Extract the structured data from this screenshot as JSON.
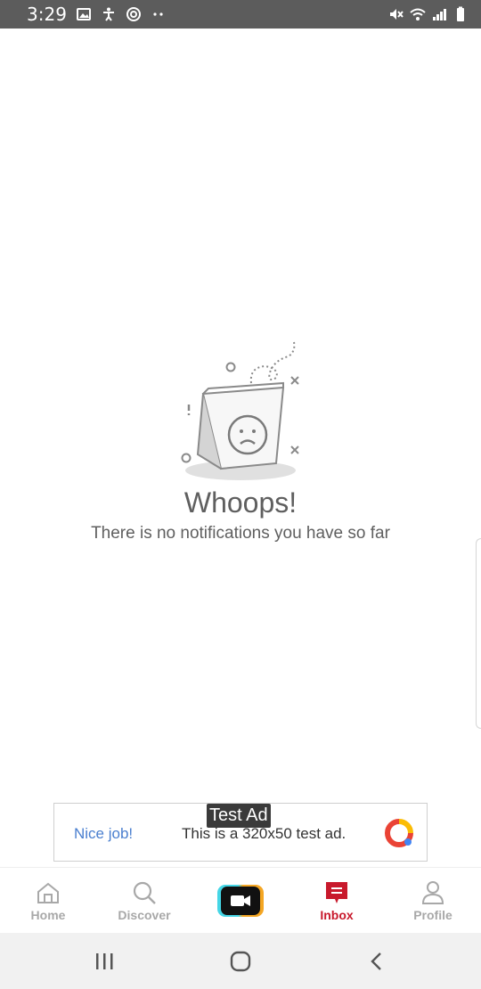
{
  "status_bar": {
    "time": "3:29",
    "left_icons": [
      "image-icon",
      "accessibility-icon",
      "sync-icon",
      "more-dots-icon"
    ],
    "right_icons": [
      "mute-icon",
      "wifi-icon",
      "signal-icon",
      "battery-icon"
    ]
  },
  "empty_state": {
    "illustration": "sad-bag-illustration",
    "title": "Whoops!",
    "subtitle": "There is no notifications you have so far"
  },
  "ad": {
    "tag": "Test Ad",
    "headline": "Nice job!",
    "text": "This is a 320x50 test ad.",
    "logo": "ad-logo-icon"
  },
  "bottom_nav": {
    "items": [
      {
        "label": "Home",
        "icon": "home-icon"
      },
      {
        "label": "Discover",
        "icon": "search-icon"
      },
      {
        "label": "",
        "icon": "record-video-icon"
      },
      {
        "label": "Inbox",
        "icon": "inbox-icon",
        "active": true
      },
      {
        "label": "Profile",
        "icon": "profile-icon"
      }
    ],
    "active_color": "#c8192c",
    "inactive_color": "#a8a8a8"
  },
  "system_nav": [
    "recents-icon",
    "home-circle-icon",
    "back-icon"
  ]
}
